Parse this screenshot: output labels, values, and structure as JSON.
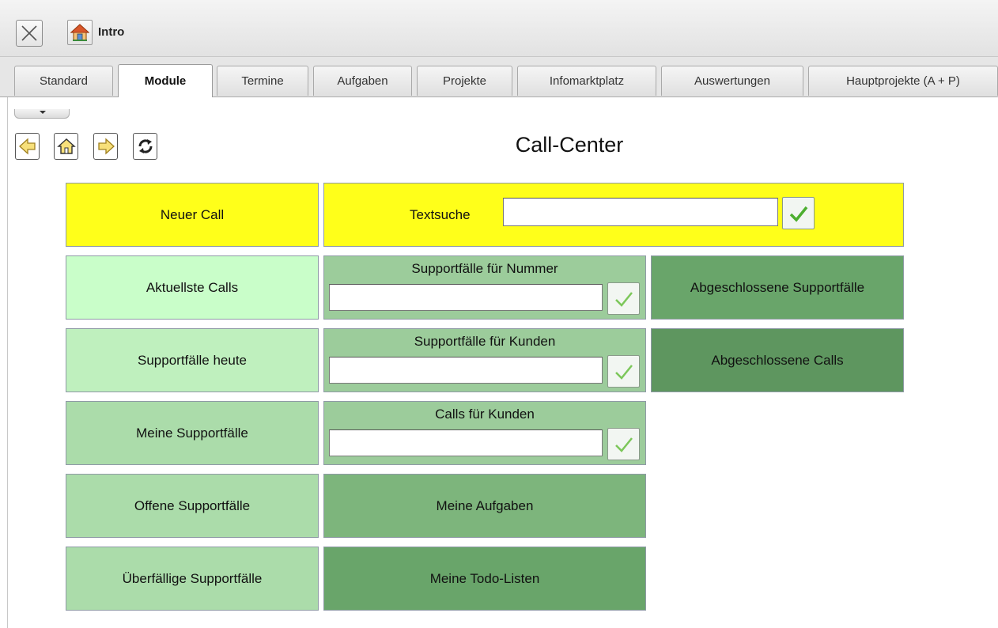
{
  "window": {
    "title": "Intro",
    "close_icon": "close-icon",
    "home_icon": "home-icon"
  },
  "tabs": [
    {
      "label": "Standard",
      "active": false
    },
    {
      "label": "Module",
      "active": true
    },
    {
      "label": "Termine",
      "active": false
    },
    {
      "label": "Aufgaben",
      "active": false
    },
    {
      "label": "Projekte",
      "active": false
    },
    {
      "label": "Infomarktplatz",
      "active": false
    },
    {
      "label": "Auswertungen",
      "active": false
    },
    {
      "label": "Hauptprojekte (A + P)",
      "active": false
    }
  ],
  "navigation": {
    "back_icon": "arrow-left-icon",
    "home_icon": "home-icon",
    "forward_icon": "arrow-right-icon",
    "refresh_icon": "refresh-icon"
  },
  "page": {
    "title": "Call-Center"
  },
  "tiles": {
    "neuer_call": "Neuer Call",
    "textsuche_label": "Textsuche",
    "textsuche_value": "",
    "aktuellste_calls": "Aktuellste Calls",
    "supportfaelle_nummer_label": "Supportfälle für Nummer",
    "supportfaelle_nummer_value": "",
    "abgeschlossene_supportfaelle": "Abgeschlossene Supportfälle",
    "supportfaelle_heute": "Supportfälle heute",
    "supportfaelle_kunden_label": "Supportfälle für Kunden",
    "supportfaelle_kunden_value": "",
    "abgeschlossene_calls": "Abgeschlossene Calls",
    "meine_supportfaelle": "Meine Supportfälle",
    "calls_kunden_label": "Calls für Kunden",
    "calls_kunden_value": "",
    "offene_supportfaelle": "Offene Supportfälle",
    "meine_aufgaben": "Meine Aufgaben",
    "ueberfaellige_supportfaelle": "Überfällige Supportfälle",
    "meine_todo_listen": "Meine Todo-Listen"
  },
  "colors": {
    "yellow": "#ffff1a",
    "mint_light": "#c9fec9",
    "green_dark": "#5e965f"
  }
}
